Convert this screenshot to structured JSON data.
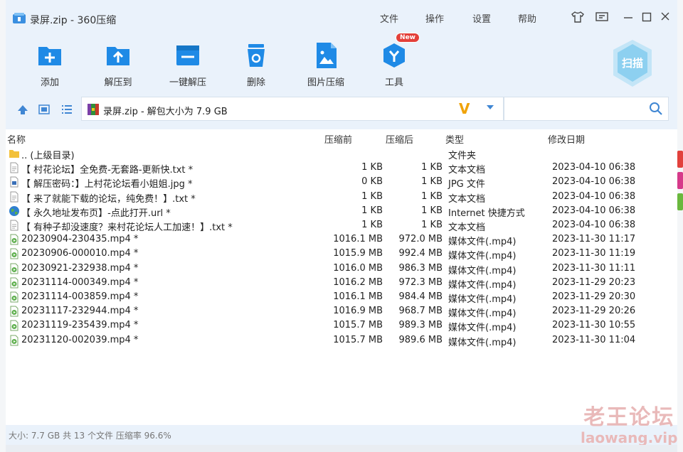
{
  "title": "录屏.zip - 360压缩",
  "menu": [
    "文件",
    "操作",
    "设置",
    "帮助"
  ],
  "toolbar": [
    {
      "label": "添加",
      "icon": "add-icon"
    },
    {
      "label": "解压到",
      "icon": "extract-to-icon"
    },
    {
      "label": "一键解压",
      "icon": "one-click-extract-icon"
    },
    {
      "label": "删除",
      "icon": "delete-icon"
    },
    {
      "label": "图片压缩",
      "icon": "image-compress-icon"
    },
    {
      "label": "工具",
      "icon": "tools-icon",
      "badge": "New"
    }
  ],
  "scan_label": "扫描",
  "address": {
    "text": "录屏.zip - 解包大小为 7.9 GB"
  },
  "search": {
    "placeholder": ""
  },
  "columns": {
    "name": "名称",
    "compressed": "压缩前",
    "original": "压缩后",
    "type": "类型",
    "modified": "修改日期"
  },
  "files": [
    {
      "name": ".. (上级目录)",
      "compressed": "",
      "original": "",
      "type": "文件夹",
      "modified": "",
      "icon": "folder-icon"
    },
    {
      "name": "【 村花论坛】全免费-无套路-更新快.txt *",
      "compressed": "1 KB",
      "original": "1 KB",
      "type": "文本文档",
      "modified": "2023-04-10 06:38",
      "icon": "text-file-icon"
    },
    {
      "name": "【 解压密码：】上村花论坛看小姐姐.jpg *",
      "compressed": "0 KB",
      "original": "1 KB",
      "type": "JPG 文件",
      "modified": "2023-04-10 06:38",
      "icon": "image-file-icon"
    },
    {
      "name": "【 来了就能下载的论坛，纯免费！】.txt *",
      "compressed": "1 KB",
      "original": "1 KB",
      "type": "文本文档",
      "modified": "2023-04-10 06:38",
      "icon": "text-file-icon"
    },
    {
      "name": "【 永久地址发布页】-点此打开.url *",
      "compressed": "1 KB",
      "original": "1 KB",
      "type": "Internet 快捷方式",
      "modified": "2023-04-10 06:38",
      "icon": "globe-icon"
    },
    {
      "name": "【 有种子却没速度？来村花论坛人工加速！】.txt *",
      "compressed": "1 KB",
      "original": "1 KB",
      "type": "文本文档",
      "modified": "2023-04-10 06:38",
      "icon": "text-file-icon"
    },
    {
      "name": "20230904-230435.mp4 *",
      "compressed": "1016.1 MB",
      "original": "972.0 MB",
      "type": "媒体文件(.mp4)",
      "modified": "2023-11-30 11:17",
      "icon": "video-file-icon"
    },
    {
      "name": "20230906-000010.mp4 *",
      "compressed": "1015.9 MB",
      "original": "992.4 MB",
      "type": "媒体文件(.mp4)",
      "modified": "2023-11-30 11:19",
      "icon": "video-file-icon"
    },
    {
      "name": "20230921-232938.mp4 *",
      "compressed": "1016.0 MB",
      "original": "986.3 MB",
      "type": "媒体文件(.mp4)",
      "modified": "2023-11-30 11:11",
      "icon": "video-file-icon"
    },
    {
      "name": "20231114-000349.mp4 *",
      "compressed": "1016.2 MB",
      "original": "972.3 MB",
      "type": "媒体文件(.mp4)",
      "modified": "2023-11-29 20:23",
      "icon": "video-file-icon"
    },
    {
      "name": "20231114-003859.mp4 *",
      "compressed": "1016.1 MB",
      "original": "984.4 MB",
      "type": "媒体文件(.mp4)",
      "modified": "2023-11-29 20:30",
      "icon": "video-file-icon"
    },
    {
      "name": "20231117-232944.mp4 *",
      "compressed": "1016.9 MB",
      "original": "968.7 MB",
      "type": "媒体文件(.mp4)",
      "modified": "2023-11-29 20:26",
      "icon": "video-file-icon"
    },
    {
      "name": "20231119-235439.mp4 *",
      "compressed": "1015.7 MB",
      "original": "989.3 MB",
      "type": "媒体文件(.mp4)",
      "modified": "2023-11-30 10:55",
      "icon": "video-file-icon"
    },
    {
      "name": "20231120-002039.mp4 *",
      "compressed": "1015.7 MB",
      "original": "989.6 MB",
      "type": "媒体文件(.mp4)",
      "modified": "2023-11-30 11:04",
      "icon": "video-file-icon"
    }
  ],
  "status": "大小: 7.7 GB 共 13 个文件 压缩率 96.6%",
  "watermark": {
    "line1": "老王论坛",
    "line2": "laowang.vip"
  },
  "colors": {
    "accent": "#2f8fe0",
    "toolbar_bg": "#eaf2fb",
    "highlight": "#f0a30a",
    "new_badge": "#e3403a"
  }
}
